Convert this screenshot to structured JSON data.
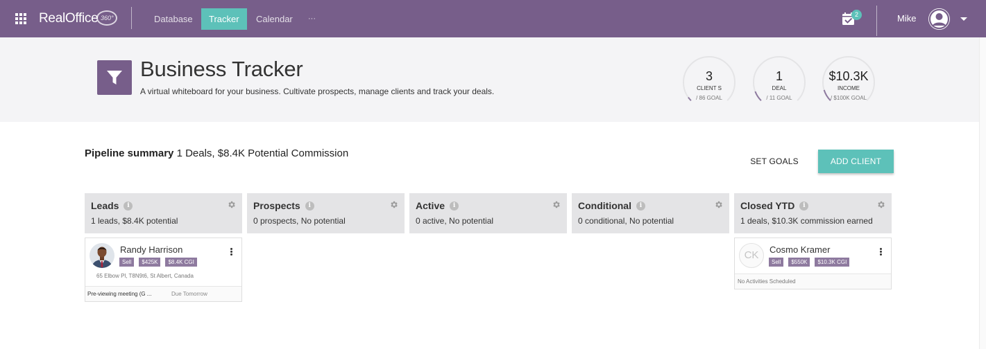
{
  "app": {
    "brand": "RealOffice",
    "brand_suffix": "360°",
    "nav": [
      "Database",
      "Tracker",
      "Calendar",
      "···"
    ],
    "active_nav": "Tracker",
    "notification_count": "2",
    "user_name": "Mike",
    "accent_color": "#775e8a",
    "highlight_color": "#5dc1b9"
  },
  "header": {
    "title": "Business Tracker",
    "subtitle": "A virtual whiteboard for your business. Cultivate prospects, manage clients and track your deals.",
    "gauges": [
      {
        "value": "3",
        "label": "CLIENT S",
        "goal": "/ 86 GOAL",
        "progress": 0.035
      },
      {
        "value": "1",
        "label": "DEAL",
        "goal": "/ 11 GOAL",
        "progress": 0.09
      },
      {
        "value": "$10.3K",
        "label": "INCOME",
        "goal": "/ $100K GOAL",
        "progress": 0.103
      }
    ]
  },
  "pipeline": {
    "title": "Pipeline summary",
    "summary": "1 Deals, $8.4K Potential Commission",
    "set_goals_label": "SET GOALS",
    "add_client_label": "ADD CLIENT",
    "columns": [
      {
        "name": "Leads",
        "sub": "1 leads, $8.4K potential"
      },
      {
        "name": "Prospects",
        "sub": "0 prospects, No potential"
      },
      {
        "name": "Active",
        "sub": "0 active, No potential"
      },
      {
        "name": "Conditional",
        "sub": "0 conditional, No potential"
      },
      {
        "name": "Closed YTD",
        "sub": "1 deals, $10.3K commission earned"
      }
    ],
    "cards": [
      {
        "name": "Randy Harrison",
        "tags": [
          "Sell",
          "$425K",
          "$8.4K CGI"
        ],
        "address": "65 Elbow Pl, T8N9t6, St Albert, Canada",
        "activity": "Pre-viewing meeting (G ...",
        "due": "Due Tomorrow"
      },
      {
        "name": "Cosmo Kramer",
        "initials": "CK",
        "tags": [
          "Sell",
          "$550K",
          "$10.3K CGI"
        ],
        "activity": "No Activities Scheduled"
      }
    ]
  }
}
